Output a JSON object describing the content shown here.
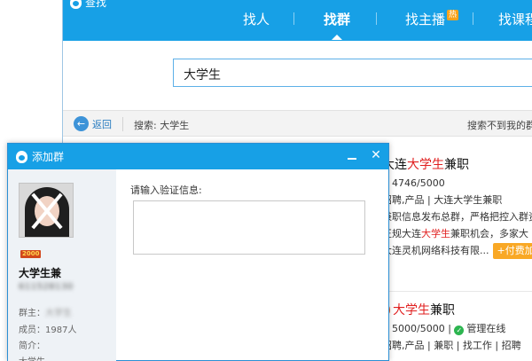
{
  "find_window": {
    "title": "查找",
    "tabs": [
      {
        "label": "找人"
      },
      {
        "label": "找群"
      },
      {
        "label": "找主播",
        "badge": "热"
      },
      {
        "label": "找课程"
      }
    ],
    "active_tab": "找群",
    "search_value": "大学生",
    "back_label": "返回",
    "search_crumb": "搜索: 大学生",
    "not_found_text": "搜索不到我的群"
  },
  "results": [
    {
      "name_prefix": "大连",
      "name_keyword": "大学生",
      "name_suffix": "兼职",
      "members": "4746/5000",
      "tags": "招聘,产品 | 大连大学生兼职",
      "desc_line1": "兼职信息发布总群，严格把控入群资",
      "desc_line2_pre": "正规大连",
      "desc_line2_kw": "大学生",
      "desc_line2_post": "兼职机会，多家大",
      "owner": "大连灵机网络科技有限...",
      "join_label": "+付费加群"
    },
    {
      "name_prefix": "",
      "name_keyword": "大学生",
      "name_suffix": "兼职",
      "members": "5000/5000",
      "status": "管理在线",
      "tags": "招聘,产品 | 兼职 | 找工作 | 招聘"
    }
  ],
  "dialog": {
    "title": "添加群",
    "level_badge": "2000",
    "group_name": "大学生兼",
    "group_id": "611528130",
    "owner_label": "群主：",
    "owner_value": "大学生",
    "members_text": "成员：1987人",
    "intro_label": "简介：",
    "intro_value": "大学生",
    "verify_label": "请输入验证信息:",
    "verify_value": ""
  },
  "colors": {
    "titlebar": "#17a0e6",
    "keyword": "#e02020",
    "join_button": "#f9a825",
    "online": "#2db550"
  }
}
